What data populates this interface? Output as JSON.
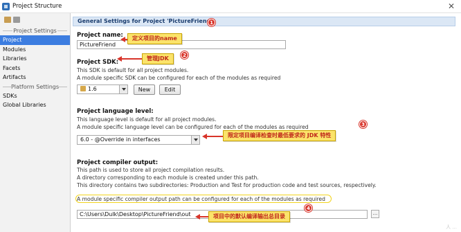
{
  "window": {
    "title": "Project Structure",
    "close_glyph": "✕"
  },
  "sidebar": {
    "sections": [
      {
        "title": "Project Settings",
        "items": [
          "Project",
          "Modules",
          "Libraries",
          "Facets",
          "Artifacts"
        ]
      },
      {
        "title": "Platform Settings",
        "items": [
          "SDKs",
          "Global Libraries"
        ]
      }
    ],
    "selected": "Project"
  },
  "panel": {
    "header": "General Settings for Project 'PictureFriend'",
    "project_name": {
      "label": "Project name:",
      "value": "PictureFriend"
    },
    "project_sdk": {
      "label": "Project SDK:",
      "help1": "This SDK is default for all project modules.",
      "help2": "A module specific SDK can be configured for each of the modules as required",
      "selected": "1.6",
      "new_label": "New",
      "edit_label": "Edit"
    },
    "language_level": {
      "label": "Project language level:",
      "help1": "This language level is default for all project modules.",
      "help2": "A module specific language level can be configured for each of the modules as required",
      "selected": "6.0 - @Override in interfaces"
    },
    "compiler_output": {
      "label": "Project compiler output:",
      "help1": "This path is used to store all project compilation results.",
      "help2": "A directory corresponding to each module is created under this path.",
      "help3": "This directory contains two subdirectories: Production and Test for production code and test sources, respectively.",
      "help4": "A module specific compiler output path can be configured for each of the modules as required",
      "path": "C:\\Users\\Dulk\\Desktop\\PictureFriend\\out",
      "browse_label": "..."
    }
  },
  "annotations": [
    {
      "number": "1",
      "text": "定义项目的name"
    },
    {
      "number": "2",
      "text": "管理JDK"
    },
    {
      "number": "3",
      "text": "限定项目编译检查时最低要求的 JDK 特性"
    },
    {
      "number": "4",
      "text": "项目中的默认编译输出总目录"
    }
  ],
  "watermark": "人 ...",
  "colors": {
    "selection": "#3c7de0",
    "callout_bg": "#fbe36a",
    "callout_text": "#c0271b",
    "badge": "#d8342a",
    "highlight": "#f2d31b",
    "header_bg": "#dbe7f5"
  }
}
